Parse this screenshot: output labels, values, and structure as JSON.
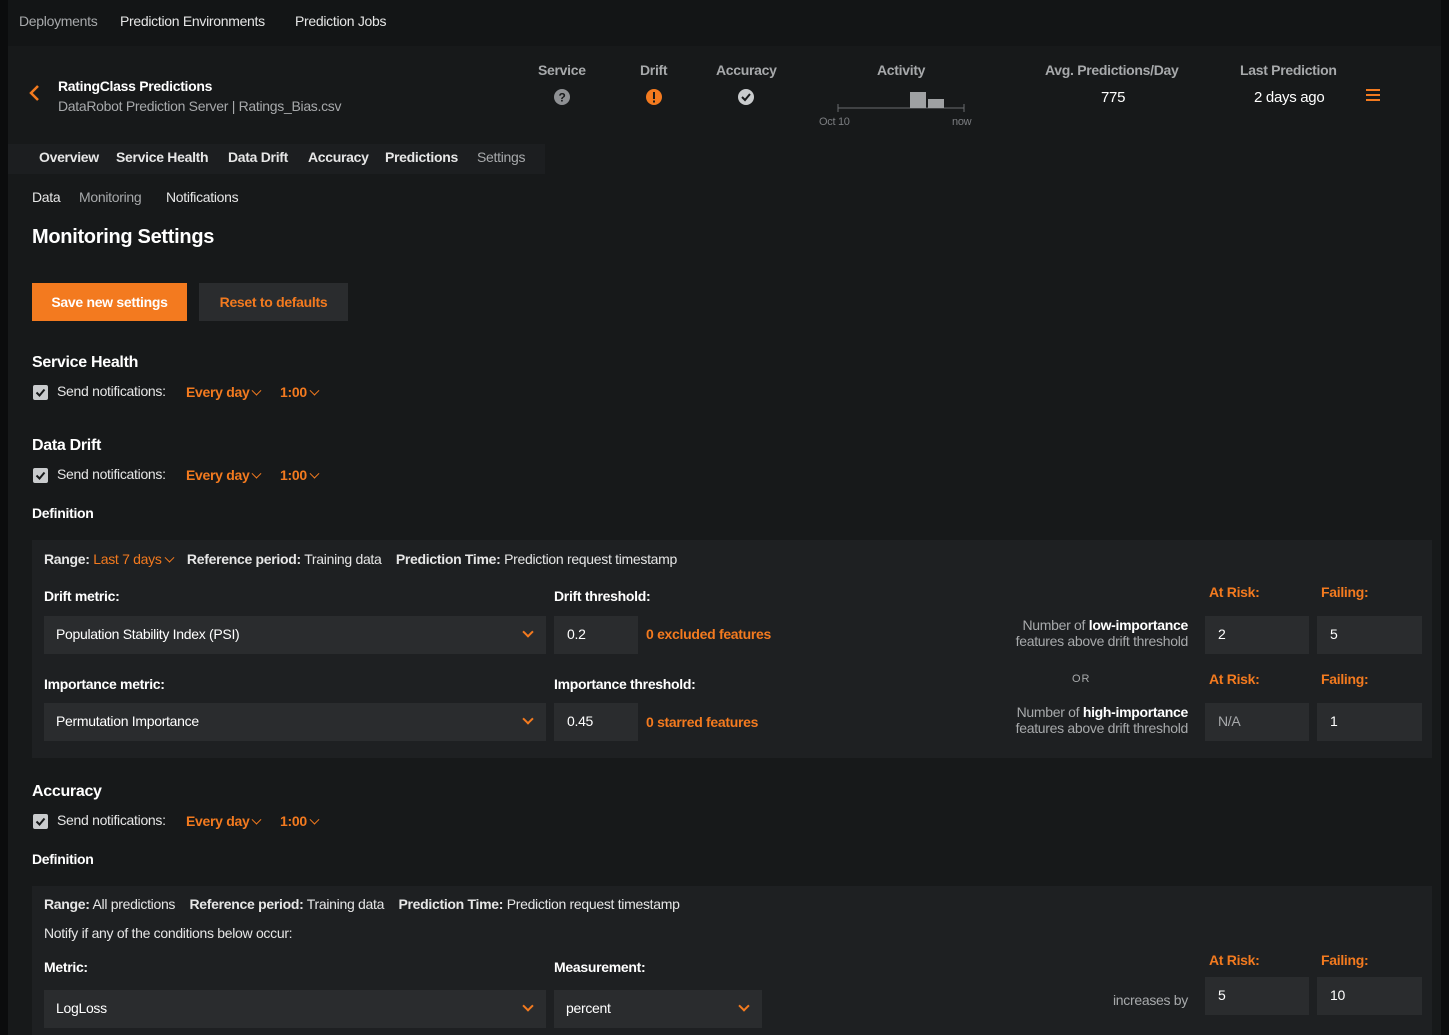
{
  "topnav": {
    "items": [
      "Deployments",
      "Prediction Environments",
      "Prediction Jobs"
    ]
  },
  "deployment": {
    "title": "RatingClass Predictions",
    "subtitle": "DataRobot Prediction Server | Ratings_Bias.csv",
    "stats": {
      "service_label": "Service",
      "drift_label": "Drift",
      "accuracy_label": "Accuracy",
      "activity_label": "Activity",
      "activity_start": "Oct 10",
      "activity_end": "now",
      "avg_label": "Avg. Predictions/Day",
      "avg_value": "775",
      "last_label": "Last Prediction",
      "last_value": "2 days ago"
    },
    "status_colors": {
      "service": "#8e9093",
      "drift": "#f37a1f",
      "accuracy": "#c9cbcd"
    }
  },
  "tabs": [
    "Overview",
    "Service Health",
    "Data Drift",
    "Accuracy",
    "Predictions",
    "Settings"
  ],
  "subtabs": [
    "Data",
    "Monitoring",
    "Notifications"
  ],
  "page_title": "Monitoring Settings",
  "buttons": {
    "save": "Save new settings",
    "reset": "Reset to defaults"
  },
  "service_health": {
    "title": "Service Health",
    "send_label": "Send notifications:",
    "frequency": "Every day",
    "time": "1:00",
    "checked": true
  },
  "data_drift": {
    "title": "Data Drift",
    "send_label": "Send notifications:",
    "frequency": "Every day",
    "time": "1:00",
    "checked": true,
    "definition_label": "Definition",
    "range_label": "Range:",
    "range_value": "Last 7 days",
    "ref_label": "Reference period:",
    "ref_value": "Training data",
    "pred_time_label": "Prediction Time:",
    "pred_time_value": "Prediction request timestamp",
    "drift_metric_label": "Drift metric:",
    "drift_metric_value": "Population Stability Index (PSI)",
    "drift_threshold_label": "Drift threshold:",
    "drift_threshold_value": "0.2",
    "excluded_link": "0 excluded features",
    "importance_metric_label": "Importance metric:",
    "importance_metric_value": "Permutation Importance",
    "importance_threshold_label": "Importance threshold:",
    "importance_threshold_value": "0.45",
    "starred_link": "0 starred features",
    "at_risk_label": "At Risk:",
    "failing_label": "Failing:",
    "low_note_pre": "Number of",
    "low_note_bold": "low-importance",
    "low_note_post": "features above drift threshold",
    "high_note_pre": "Number of",
    "high_note_bold": "high-importance",
    "high_note_post": "features above drift threshold",
    "or_label": "OR",
    "low_at_risk": "2",
    "low_failing": "5",
    "high_at_risk": "N/A",
    "high_failing": "1"
  },
  "accuracy": {
    "title": "Accuracy",
    "send_label": "Send notifications:",
    "frequency": "Every day",
    "time": "1:00",
    "checked": true,
    "definition_label": "Definition",
    "range_label": "Range:",
    "range_value": "All predictions",
    "ref_label": "Reference period:",
    "ref_value": "Training data",
    "pred_time_label": "Prediction Time:",
    "pred_time_value": "Prediction request timestamp",
    "notify_text": "Notify if any of the conditions below occur:",
    "metric_label": "Metric:",
    "metric_value": "LogLoss",
    "measurement_label": "Measurement:",
    "measurement_value": "percent",
    "at_risk_label": "At Risk:",
    "failing_label": "Failing:",
    "increases_label": "increases by",
    "at_risk_value": "5",
    "failing_value": "10"
  },
  "accent_color": "#f37a1f"
}
